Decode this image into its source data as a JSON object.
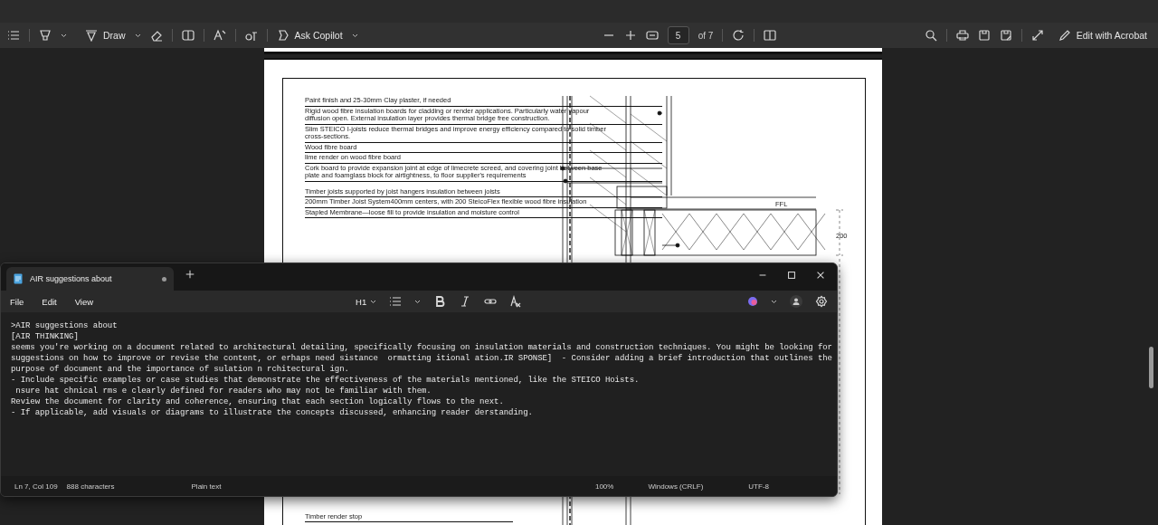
{
  "toolbar": {
    "draw_label": "Draw",
    "copilot_label": "Ask Copilot",
    "page_field": "5",
    "page_total": "of 7",
    "edit_button": "Edit with Acrobat"
  },
  "drawing": {
    "labels": [
      "Paint finish and 25-30mm Clay plaster, if needed",
      "Rigid wood fibre insulation boards for cladding or render applications. Particularly water vapour diffusion open. External insulation layer provides thermal bridge free construction.",
      "Slim STEICO I-joists reduce thermal bridges and improve energy efficiency compared to solid timber cross-sections.",
      "Wood fibre board",
      "lime render on wood fibre board",
      "Cork board to provide expansion joint at edge of limecrete screed, and covering joint between base plate and foamglass block for airtightness, to floor supplier's requirements",
      "Timber joists supported by joist hangers insulation between joists",
      "200mm Timber Joist System400mm centers, with 200 SteicoFlex flexible wood fibre insulation",
      "Stapled Membrane—loose fill to provide insulation and moisture control"
    ],
    "level_mark": "FFL",
    "dimension": "200",
    "bottom_label": "Timber render stop"
  },
  "notepad": {
    "tab_title": "AIR suggestions about",
    "modified": true,
    "menu": [
      "File",
      "Edit",
      "View"
    ],
    "heading_select": "H1",
    "lines": [
      ">AIR suggestions about",
      "[AIR THINKING]",
      "seems you're working on a document related to architectural detailing, specifically focusing on insulation materials and construction techniques. You might be looking for suggestions on how to improve or revise the content, or erhaps need sistance  ormatting itional ation.IR SPONSE]  - Consider adding a brief introduction that outlines the purpose of document and the importance of sulation n rchitectural ign.",
      "- Include specific examples or case studies that demonstrate the effectiveness of the materials mentioned, like the STEICO Hoists.",
      " nsure hat chnical rms e clearly defined for readers who may not be familiar with them.",
      "Review the document for clarity and coherence, ensuring that each section logically flows to the next.",
      "- If applicable, add visuals or diagrams to illustrate the concepts discussed, enhancing reader derstanding."
    ],
    "status": {
      "position": "Ln 7, Col 109",
      "characters": "888 characters",
      "format": "Plain text",
      "zoom": "100%",
      "line_ending": "Windows (CRLF)",
      "encoding": "UTF-8"
    }
  }
}
